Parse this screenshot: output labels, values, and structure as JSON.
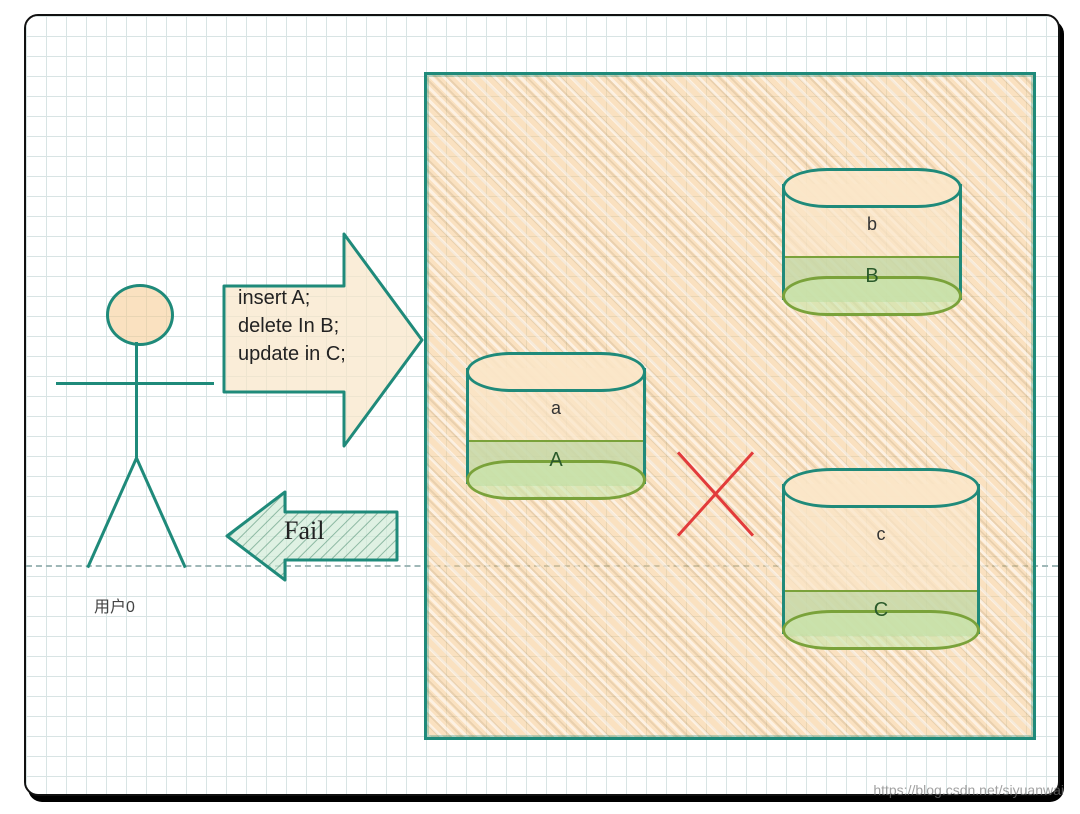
{
  "user": {
    "label": "用户0"
  },
  "request": {
    "line1": "insert A;",
    "line2": "delete In B;",
    "line3": "update in C;"
  },
  "response": {
    "status": "Fail"
  },
  "databases": {
    "a": {
      "host": "a",
      "table": "A"
    },
    "b": {
      "host": "b",
      "table": "B"
    },
    "c": {
      "host": "c",
      "table": "C"
    }
  },
  "failure_marker": "X",
  "watermark": "https://blog.csdn.net/siyuanwai"
}
